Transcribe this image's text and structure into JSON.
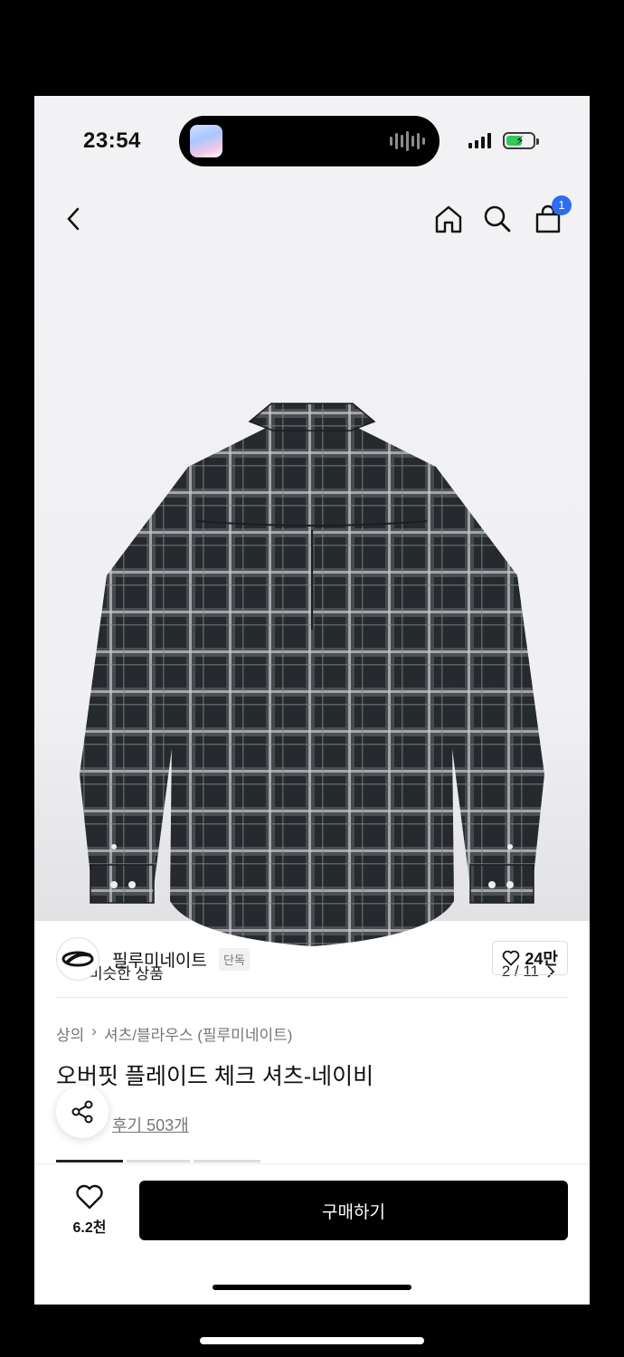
{
  "status_bar": {
    "time": "23:54"
  },
  "nav": {
    "cart_count": "1"
  },
  "image": {
    "similar_label": "비슷한 상품",
    "pager": "2 / 11"
  },
  "brand": {
    "name": "필루미네이트",
    "tag": "단독",
    "likes": "24만"
  },
  "product": {
    "breadcrumb": [
      "상의",
      "셔츠/블라우스 (필루미네이트)"
    ],
    "title": "오버핏 플레이드 체크 셔츠-네이비",
    "reviews": "후기 503개"
  },
  "bottom_bar": {
    "wish_count": "6.2천",
    "buy_label": "구매하기"
  },
  "colors": {
    "badge": "#2c6df2",
    "buy_button": "#000000",
    "battery": "#34c759"
  },
  "icons": [
    "back-icon",
    "home-icon",
    "search-icon",
    "cart-icon",
    "similar-icon",
    "chevron-right-icon",
    "heart-icon",
    "share-icon"
  ]
}
